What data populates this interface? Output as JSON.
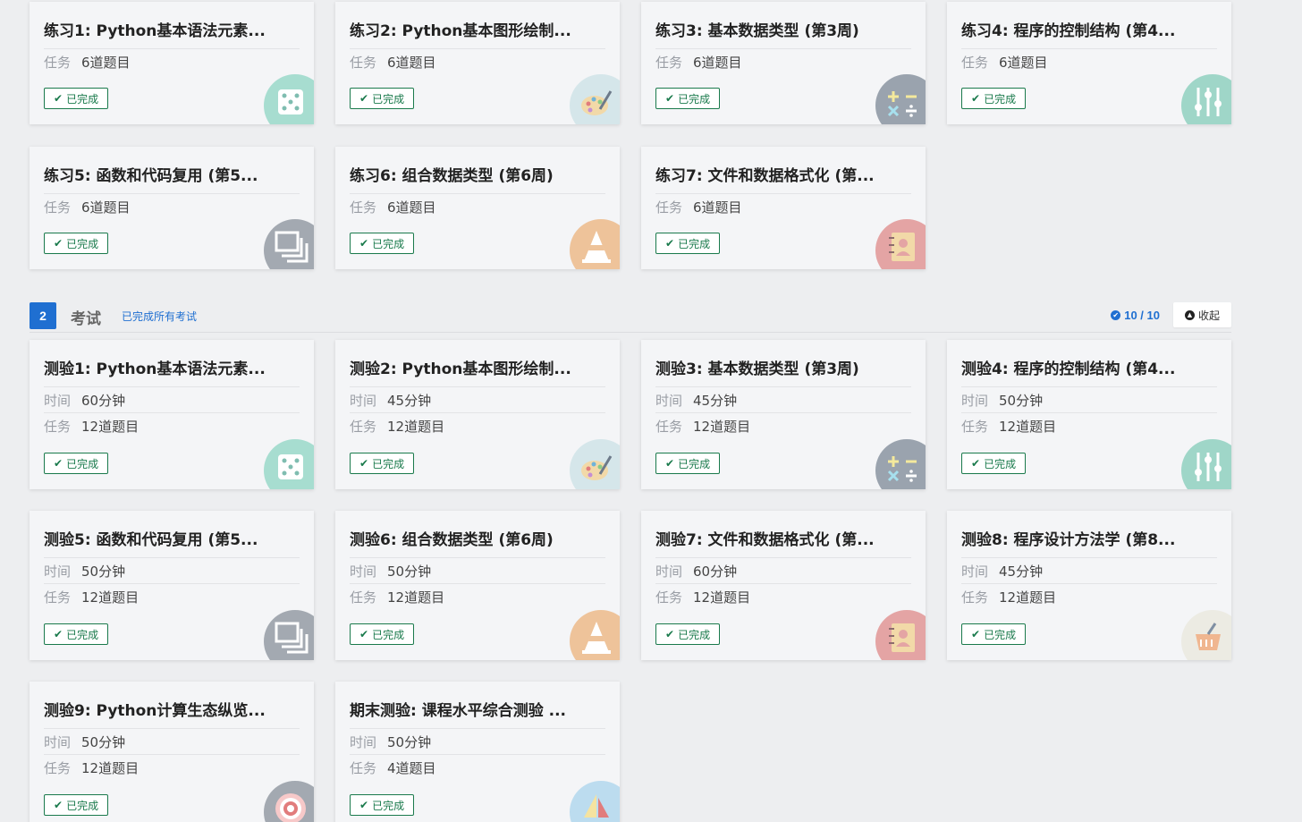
{
  "labels": {
    "task_key": "任务",
    "time_key": "时间",
    "done": "已完成"
  },
  "exercises": [
    {
      "title": "练习1: Python基本语法元素...",
      "task": "6道题目",
      "icon": "dice-icon",
      "color": "#a7ddd0"
    },
    {
      "title": "练习2: Python基本图形绘制...",
      "task": "6道题目",
      "icon": "palette-icon",
      "color": "#d5e6ea"
    },
    {
      "title": "练习3: 基本数据类型 (第3周)",
      "task": "6道题目",
      "icon": "math-icon",
      "color": "#9aa3ae"
    },
    {
      "title": "练习4: 程序的控制结构 (第4...",
      "task": "6道题目",
      "icon": "sliders-icon",
      "color": "#9fd6c8"
    },
    {
      "title": "练习5: 函数和代码复用 (第5...",
      "task": "6道题目",
      "icon": "copy-icon",
      "color": "#a3a9b1"
    },
    {
      "title": "练习6: 组合数据类型 (第6周)",
      "task": "6道题目",
      "icon": "cone-icon",
      "color": "#eec39a"
    },
    {
      "title": "练习7: 文件和数据格式化 (第...",
      "task": "6道题目",
      "icon": "contacts-icon",
      "color": "#e4a4a4"
    }
  ],
  "exam_section": {
    "number": "2",
    "title": "考试",
    "subtitle": "已完成所有考试",
    "count": "10 / 10",
    "collapse_label": "收起"
  },
  "exams": [
    {
      "title": "测验1: Python基本语法元素...",
      "time": "60分钟",
      "task": "12道题目",
      "icon": "dice-icon",
      "color": "#a7ddd0"
    },
    {
      "title": "测验2: Python基本图形绘制...",
      "time": "45分钟",
      "task": "12道题目",
      "icon": "palette-icon",
      "color": "#d5e6ea"
    },
    {
      "title": "测验3: 基本数据类型 (第3周)",
      "time": "45分钟",
      "task": "12道题目",
      "icon": "math-icon",
      "color": "#9aa3ae"
    },
    {
      "title": "测验4: 程序的控制结构 (第4...",
      "time": "50分钟",
      "task": "12道题目",
      "icon": "sliders-icon",
      "color": "#9fd6c8"
    },
    {
      "title": "测验5: 函数和代码复用 (第5...",
      "time": "50分钟",
      "task": "12道题目",
      "icon": "copy-icon",
      "color": "#a3a9b1"
    },
    {
      "title": "测验6: 组合数据类型 (第6周)",
      "time": "50分钟",
      "task": "12道题目",
      "icon": "cone-icon",
      "color": "#eec39a"
    },
    {
      "title": "测验7: 文件和数据格式化 (第...",
      "time": "60分钟",
      "task": "12道题目",
      "icon": "contacts-icon",
      "color": "#e4a4a4"
    },
    {
      "title": "测验8: 程序设计方法学 (第8...",
      "time": "45分钟",
      "task": "12道题目",
      "icon": "basket-icon",
      "color": "#ecebe3"
    },
    {
      "title": "测验9: Python计算生态纵览...",
      "time": "50分钟",
      "task": "12道题目",
      "icon": "target-icon",
      "color": "#a3a9b1"
    },
    {
      "title": "期末测验: 课程水平综合测验 ...",
      "time": "50分钟",
      "task": "4道题目",
      "icon": "sail-icon",
      "color": "#bcdcef"
    }
  ]
}
